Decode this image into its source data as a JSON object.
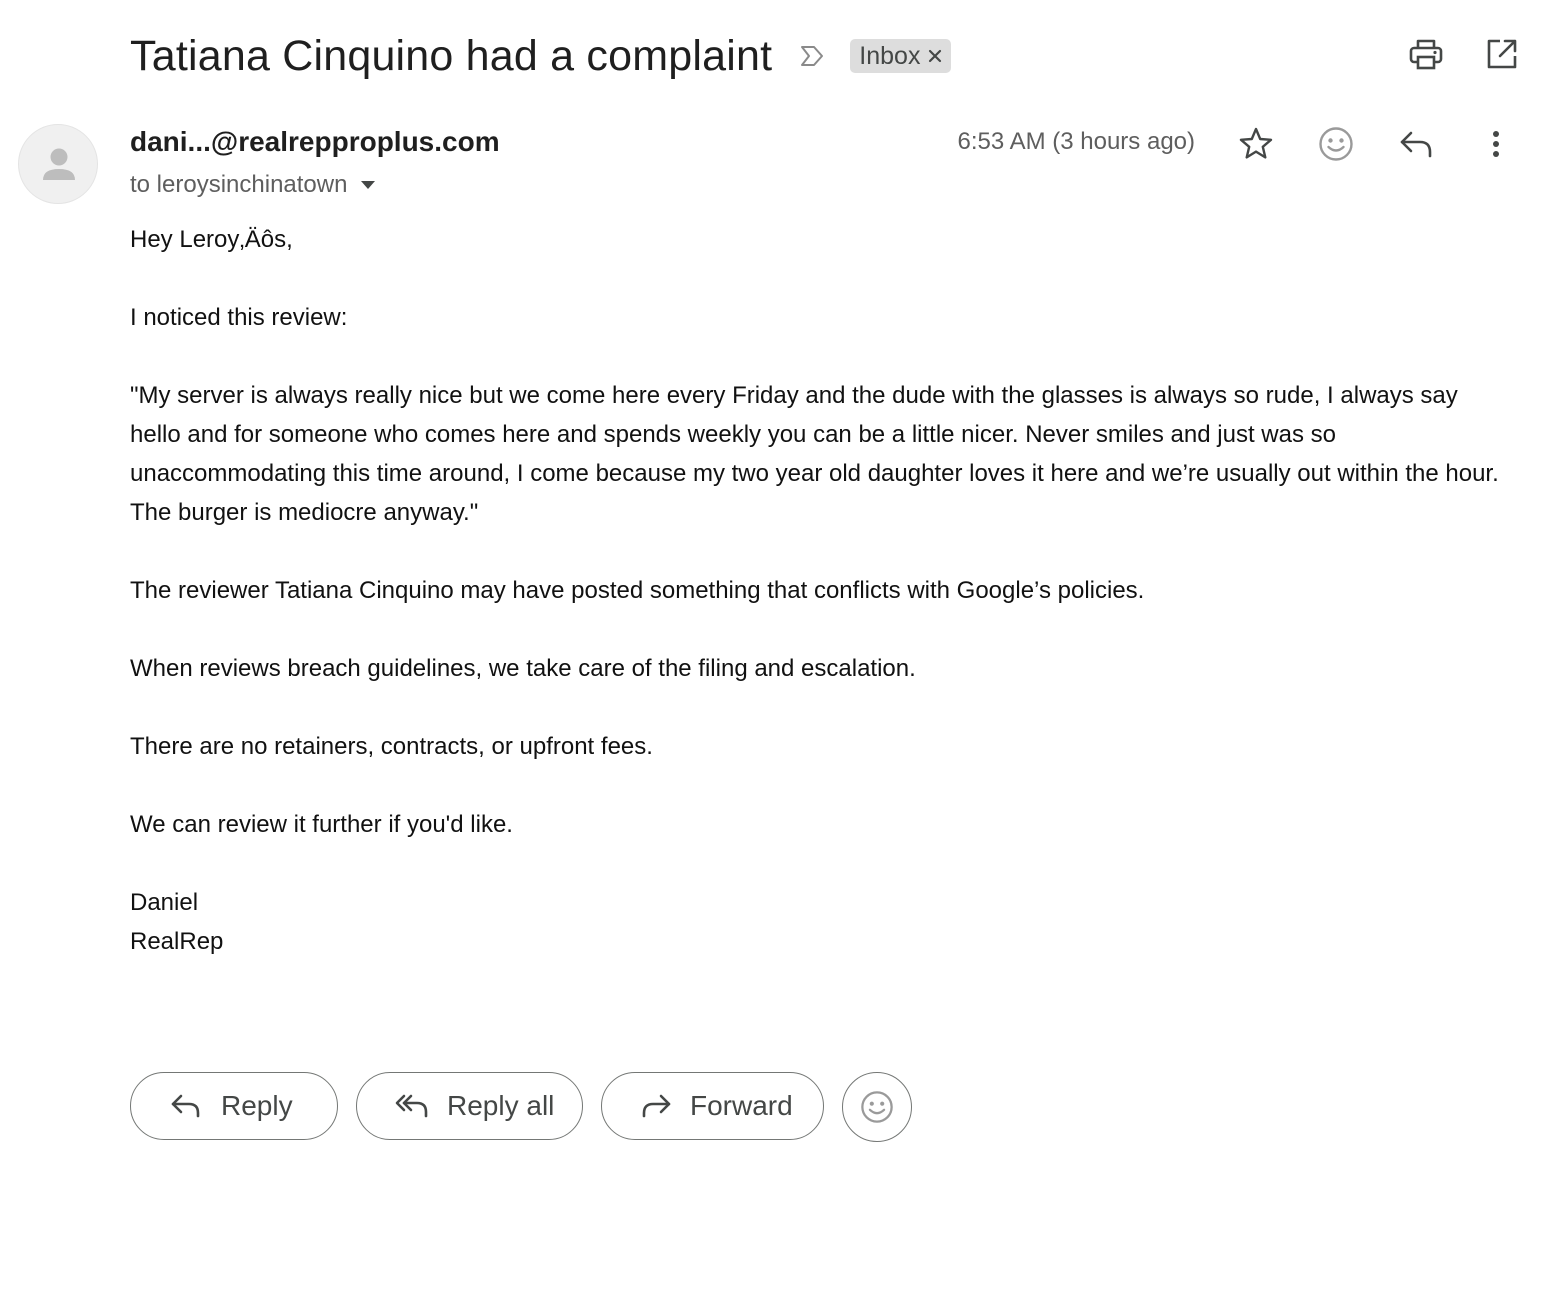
{
  "subject": {
    "title": "Tatiana Cinquino had a complaint",
    "important_icon": "important-marker-icon",
    "label": "Inbox"
  },
  "header_actions": {
    "print_icon": "print-icon",
    "open_new_window_icon": "open-in-new-window-icon"
  },
  "message": {
    "sender": "dani...@realrepproplus.com",
    "recipient": "to leroysinchinatown",
    "timestamp": "6:53 AM (3 hours ago)",
    "actions": [
      "star-icon",
      "emoji-reaction-icon",
      "reply-icon",
      "more-vertical-icon"
    ],
    "body": {
      "greeting": "Hey Leroy‚Äôs,",
      "intro": "I noticed this review:",
      "review_quote": "\"My server is always really nice but we come here every Friday and the dude with the glasses is always so rude, I always say hello and for someone who comes here and spends weekly you can be a little nicer. Never smiles and just was so unaccommodating this time around, I come because my two year old daughter loves it here and we’re usually out within the hour. The burger is mediocre anyway.\"",
      "policy_note": "The reviewer Tatiana Cinquino may have posted something that conflicts with Google’s policies.",
      "service": "When reviews breach guidelines, we take care of the filing and escalation.",
      "fees": "There are no retainers, contracts, or upfront fees.",
      "offer": "We can review it further if you'd like.",
      "signature_name": "Daniel",
      "signature_company": "RealRep"
    }
  },
  "reply_bar": {
    "reply_label": "Reply",
    "reply_all_label": "Reply all",
    "forward_label": "Forward"
  }
}
